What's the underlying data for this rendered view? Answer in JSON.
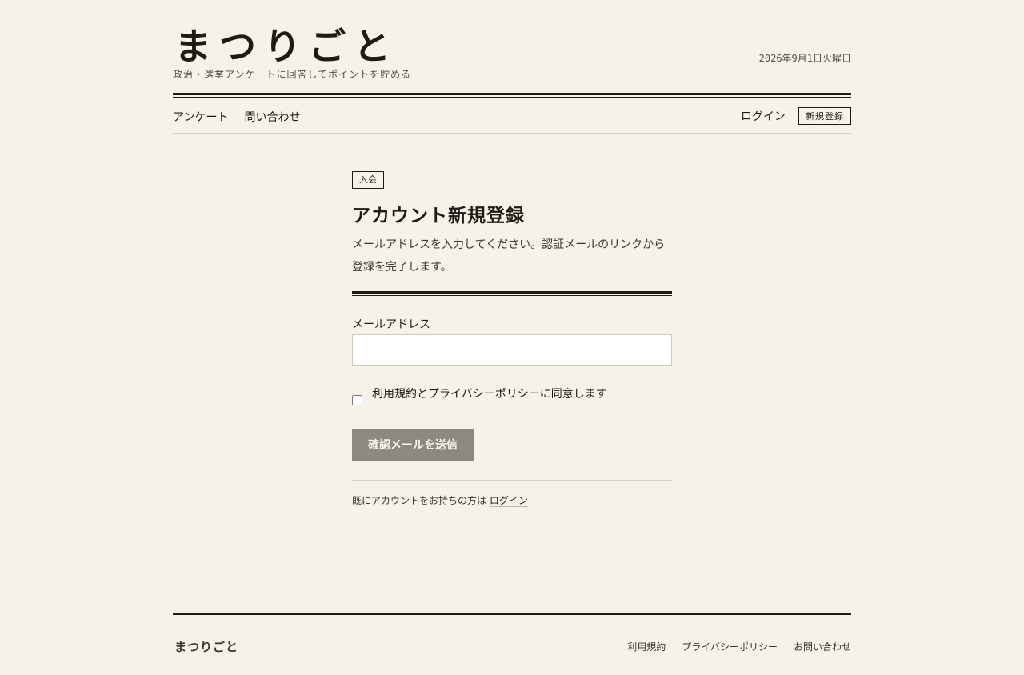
{
  "header": {
    "logo": "まつりごと",
    "tagline": "政治・選挙アンケートに回答してポイントを貯める",
    "date": "2026年9月1日火曜日"
  },
  "nav": {
    "items": [
      "アンケート",
      "問い合わせ"
    ],
    "login": "ログイン",
    "register": "新規登録"
  },
  "form": {
    "badge": "入会",
    "title": "アカウント新規登録",
    "description_line1": "メールアドレスを入力してください。認証メールのリンクから",
    "description_line2": "登録を完了します。",
    "email_label": "メールアドレス",
    "email_value": "",
    "email_placeholder": "",
    "terms_link": "利用規約",
    "terms_joiner": "と",
    "privacy_link": "プライバシーポリシー",
    "agree_suffix": "に同意します",
    "agree_checked": false,
    "submit_label": "確認メールを送信",
    "have_account": "既にアカウントをお持ちの方は",
    "login_link": "ログイン"
  },
  "footer": {
    "logo": "まつりごと",
    "links": [
      "利用規約",
      "プライバシーポリシー",
      "お問い合わせ"
    ]
  },
  "colors": {
    "background": "#f5f2e9",
    "ink": "#1e1b17",
    "button_disabled": "#8d8880"
  }
}
